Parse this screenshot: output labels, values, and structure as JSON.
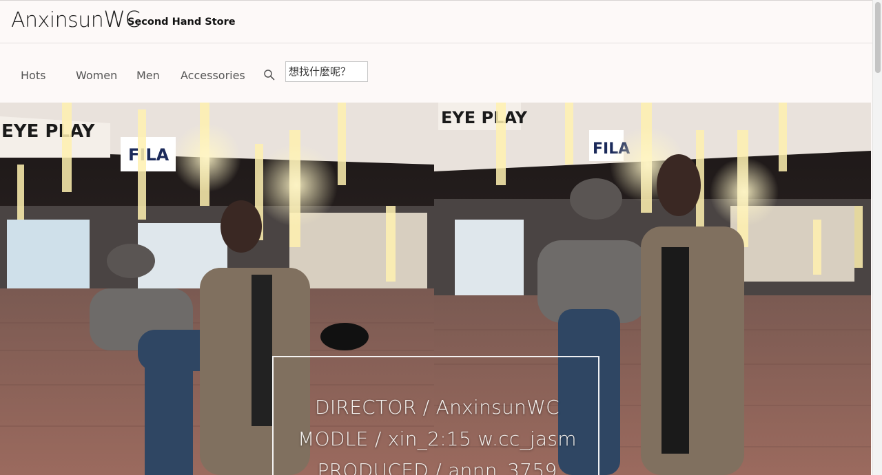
{
  "header": {
    "logo_main": "Anxinsun",
    "logo_suffix": "WC",
    "tagline": "Second Hand Store"
  },
  "nav": {
    "items": [
      {
        "label": "Hots"
      },
      {
        "label": "Women"
      },
      {
        "label": "Men"
      },
      {
        "label": "Accessories"
      }
    ],
    "search_icon": "search-icon",
    "search_placeholder": "想找什麼呢？"
  },
  "hero": {
    "credits": [
      "DIRECTOR / AnxinsunWC",
      "MODLE / xin_2:15     w.cc_jasm",
      "PRODUCED /  annn_3759"
    ],
    "signs": [
      "EYE PLAY",
      "FILA",
      "EYE PLAY",
      "FILA"
    ]
  },
  "colors": {
    "background": "#fdf9f8",
    "text": "#555555"
  }
}
